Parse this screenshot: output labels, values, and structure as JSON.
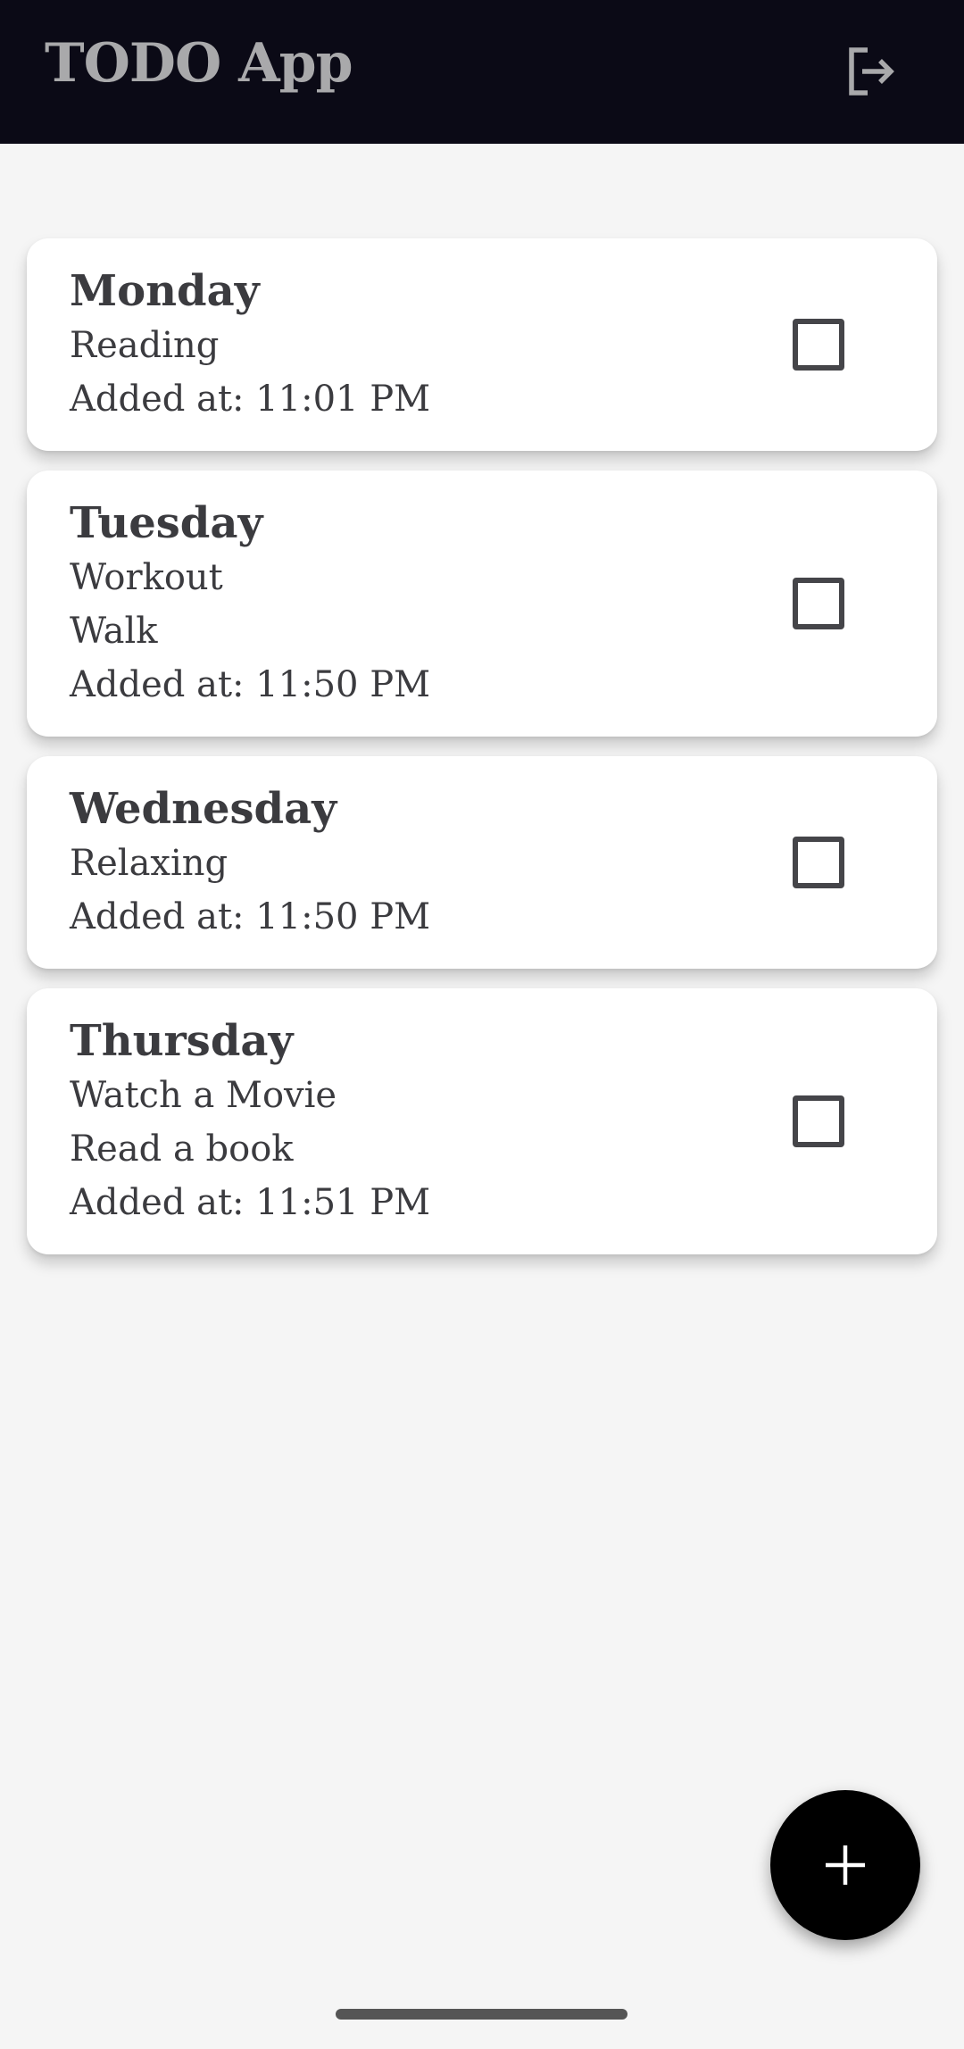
{
  "appbar": {
    "title": "TODO App",
    "logout_icon": "logout-icon"
  },
  "todos": [
    {
      "day": "Monday",
      "tasks": [
        "Reading"
      ],
      "added": "Added at: 11:01 PM",
      "checked": false
    },
    {
      "day": "Tuesday",
      "tasks": [
        "Workout",
        "Walk"
      ],
      "added": "Added at: 11:50 PM",
      "checked": false
    },
    {
      "day": "Wednesday",
      "tasks": [
        "Relaxing"
      ],
      "added": "Added at: 11:50 PM",
      "checked": false
    },
    {
      "day": "Thursday",
      "tasks": [
        "Watch a Movie",
        "Read a book"
      ],
      "added": "Added at: 11:51 PM",
      "checked": false
    }
  ],
  "fab": {
    "icon": "plus-icon"
  },
  "colors": {
    "appbar": "#0b0a16",
    "title": "#a9a9ab",
    "background": "#f5f5f5",
    "card": "#ffffff",
    "text": "#3b3b3f",
    "fab": "#000000"
  }
}
